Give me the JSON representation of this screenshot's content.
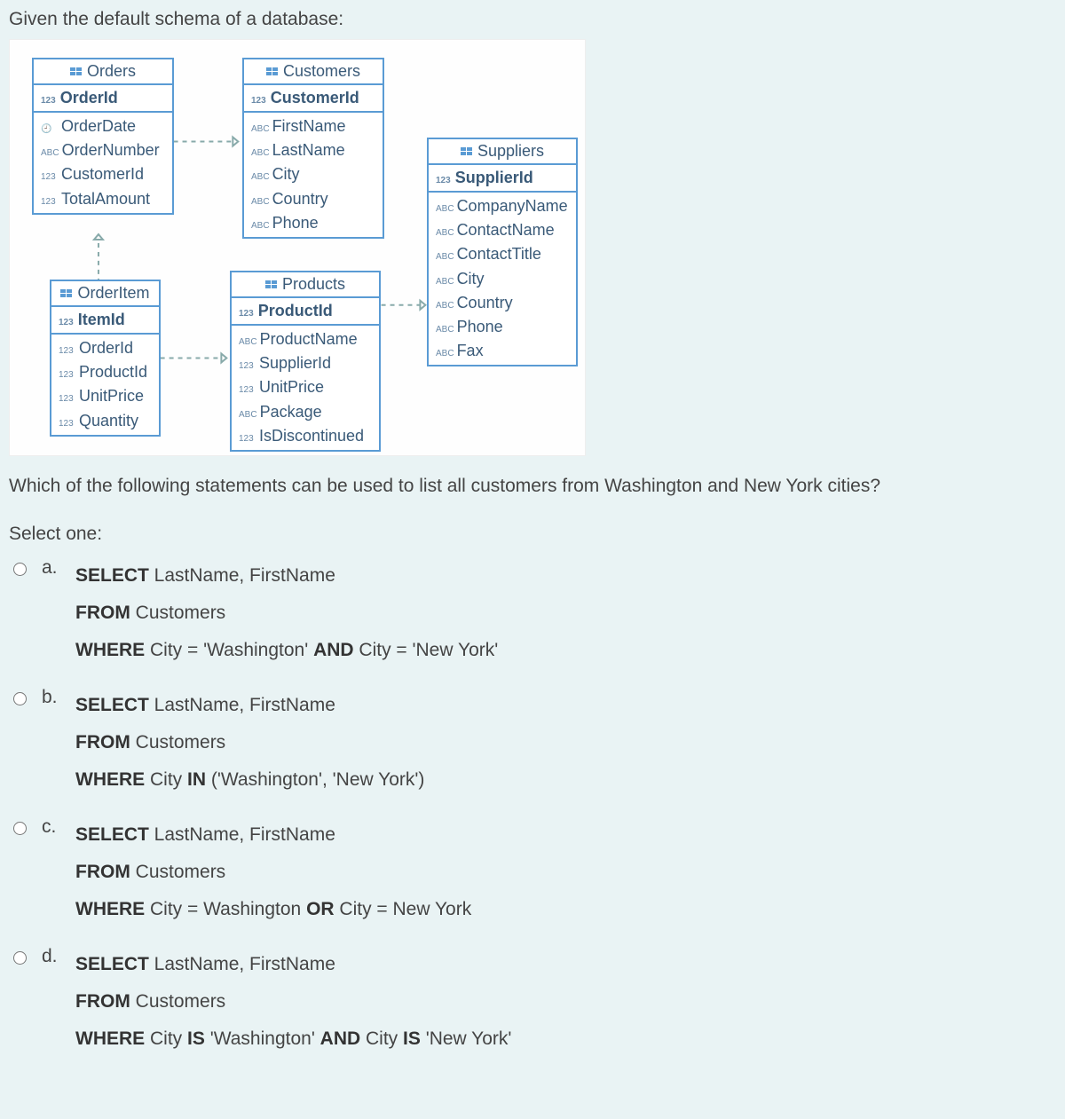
{
  "intro": "Given the default schema of a database:",
  "question": "Which of the following statements can be used to list all customers from Washington and New York cities?",
  "select_prompt": "Select one:",
  "tables": {
    "orders": {
      "title": "Orders",
      "pk_type": "123",
      "pk": "OrderId",
      "cols": [
        {
          "t": "clock",
          "n": "OrderDate"
        },
        {
          "t": "ABC",
          "n": "OrderNumber"
        },
        {
          "t": "123",
          "n": "CustomerId"
        },
        {
          "t": "123",
          "n": "TotalAmount"
        }
      ]
    },
    "customers": {
      "title": "Customers",
      "pk_type": "123",
      "pk": "CustomerId",
      "cols": [
        {
          "t": "ABC",
          "n": "FirstName"
        },
        {
          "t": "ABC",
          "n": "LastName"
        },
        {
          "t": "ABC",
          "n": "City"
        },
        {
          "t": "ABC",
          "n": "Country"
        },
        {
          "t": "ABC",
          "n": "Phone"
        }
      ]
    },
    "suppliers": {
      "title": "Suppliers",
      "pk_type": "123",
      "pk": "SupplierId",
      "cols": [
        {
          "t": "ABC",
          "n": "CompanyName"
        },
        {
          "t": "ABC",
          "n": "ContactName"
        },
        {
          "t": "ABC",
          "n": "ContactTitle"
        },
        {
          "t": "ABC",
          "n": "City"
        },
        {
          "t": "ABC",
          "n": "Country"
        },
        {
          "t": "ABC",
          "n": "Phone"
        },
        {
          "t": "ABC",
          "n": "Fax"
        }
      ]
    },
    "orderitem": {
      "title": "OrderItem",
      "pk_type": "123",
      "pk": "ItemId",
      "cols": [
        {
          "t": "123",
          "n": "OrderId"
        },
        {
          "t": "123",
          "n": "ProductId"
        },
        {
          "t": "123",
          "n": "UnitPrice"
        },
        {
          "t": "123",
          "n": "Quantity"
        }
      ]
    },
    "products": {
      "title": "Products",
      "pk_type": "123",
      "pk": "ProductId",
      "cols": [
        {
          "t": "ABC",
          "n": "ProductName"
        },
        {
          "t": "123",
          "n": "SupplierId"
        },
        {
          "t": "123",
          "n": "UnitPrice"
        },
        {
          "t": "ABC",
          "n": "Package"
        },
        {
          "t": "123",
          "n": "IsDiscontinued"
        }
      ]
    }
  },
  "options": {
    "a": {
      "letter": "a.",
      "kw1": "SELECT",
      "t1": " LastName, FirstName",
      "kw2": "FROM",
      "t2": " Customers",
      "kw3": "WHERE",
      "t3a": " City = 'Washington' ",
      "kw3b": "AND",
      "t3b": " City = 'New York'"
    },
    "b": {
      "letter": "b.",
      "kw1": "SELECT",
      "t1": " LastName, FirstName",
      "kw2": "FROM",
      "t2": " Customers",
      "kw3": "WHERE",
      "t3a": " City ",
      "kw3b": "IN",
      "t3b": " ('Washington', 'New York')"
    },
    "c": {
      "letter": "c.",
      "kw1": "SELECT",
      "t1": " LastName, FirstName",
      "kw2": "FROM",
      "t2": " Customers",
      "kw3": "WHERE",
      "t3a": " City = Washington ",
      "kw3b": "OR",
      "t3b": " City = New York"
    },
    "d": {
      "letter": "d.",
      "kw1": "SELECT",
      "t1": " LastName, FirstName",
      "kw2": "FROM",
      "t2": " Customers",
      "kw3": "WHERE",
      "t3a": " City ",
      "kw3b": "IS",
      "t3b": " 'Washington' ",
      "kw3c": "AND",
      "t3c": " City ",
      "kw3d": "IS",
      "t3d": " 'New York'"
    }
  }
}
